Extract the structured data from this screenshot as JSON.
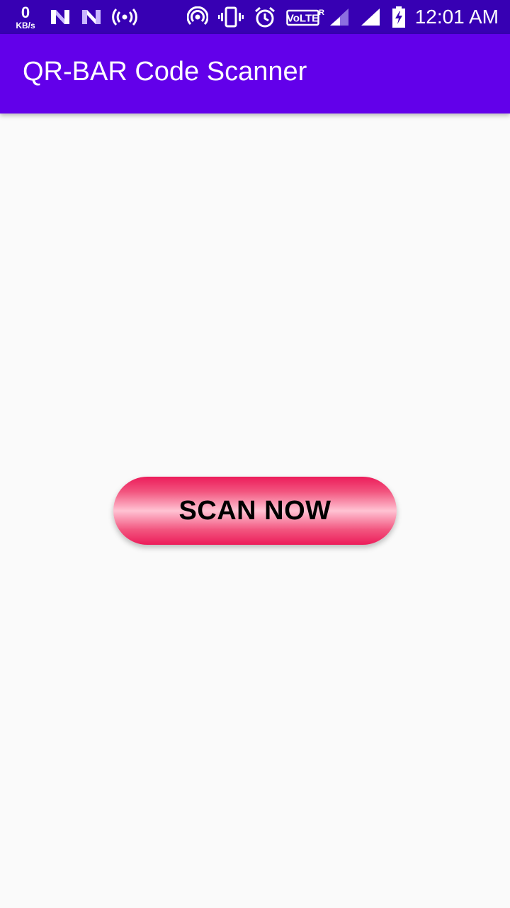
{
  "status_bar": {
    "net_speed_value": "0",
    "net_speed_unit": "KB/s",
    "icons": [
      "n-notification-icon",
      "n-notification-icon",
      "broadcast-icon",
      "hotspot-icon",
      "vibrate-icon",
      "alarm-icon",
      "volte-icon",
      "signal-roaming-icon",
      "signal-icon",
      "battery-charging-icon"
    ],
    "volte_label": "VoLTE",
    "roaming_mark": "R",
    "clock": "12:01 AM"
  },
  "app_bar": {
    "title": "QR-BAR Code Scanner"
  },
  "main": {
    "scan_button_label": "SCAN NOW"
  },
  "colors": {
    "status_bar": "#3700b3",
    "app_bar": "#6200ea",
    "background": "#fafafa",
    "button_accent": "#ec1c5a"
  }
}
